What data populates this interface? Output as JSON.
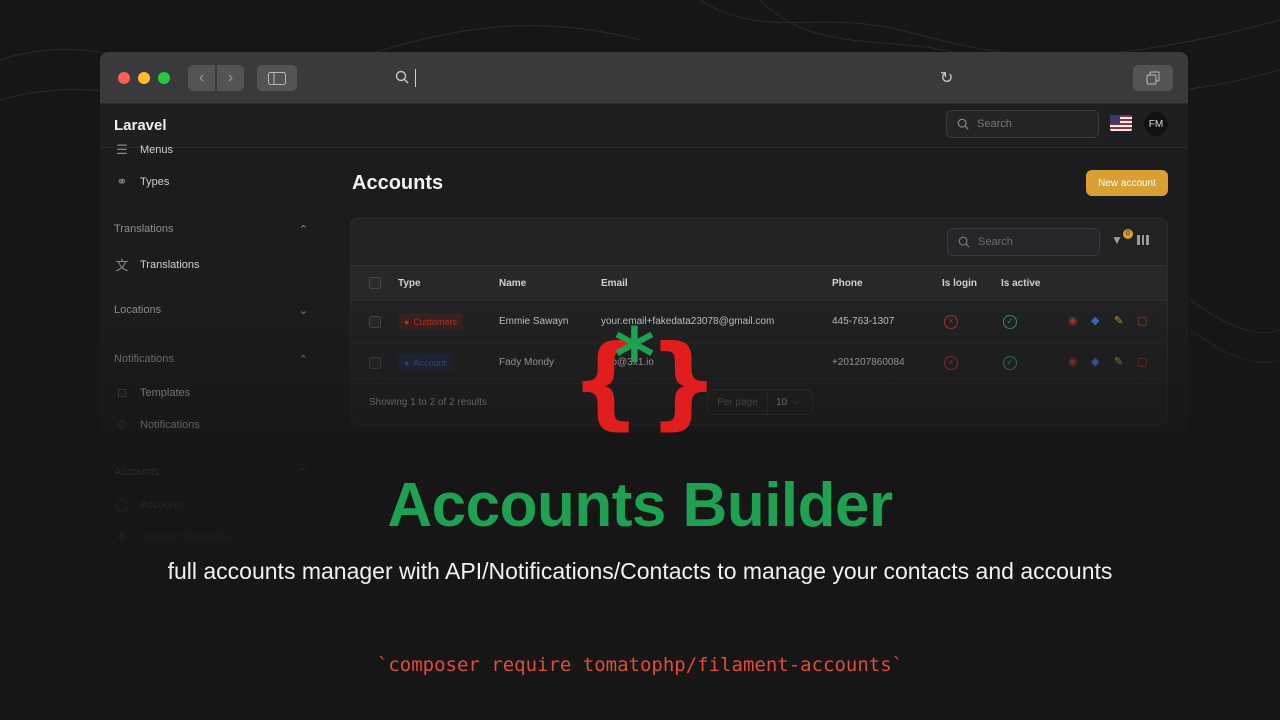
{
  "browser": {
    "url_value": ""
  },
  "app": {
    "brand": "Laravel",
    "search_placeholder": "Search",
    "user_initials": "FM"
  },
  "sidebar": {
    "items_top": [
      {
        "label": "Menus",
        "icon": "menu-icon"
      },
      {
        "label": "Types",
        "icon": "tag-icon"
      }
    ],
    "groups": [
      {
        "label": "Translations",
        "items": [
          {
            "label": "Translations",
            "icon": "translate-icon"
          }
        ]
      },
      {
        "label": "Locations",
        "items": []
      },
      {
        "label": "Notifications",
        "items": [
          {
            "label": "Templates",
            "icon": "bookmark-icon"
          },
          {
            "label": "Notifications",
            "icon": "bell-icon"
          }
        ]
      },
      {
        "label": "Accounts",
        "items": [
          {
            "label": "Accounts",
            "icon": "user-circle-icon"
          },
          {
            "label": "Account Requests",
            "icon": "fingerprint-icon"
          }
        ]
      },
      {
        "label": "ALC",
        "items": []
      }
    ]
  },
  "main": {
    "title": "Accounts",
    "new_button": "New account",
    "table": {
      "search_placeholder": "Search",
      "filter_count": "0",
      "columns": [
        "Type",
        "Name",
        "Email",
        "Phone",
        "Is login",
        "Is active"
      ],
      "rows": [
        {
          "type": "Customers",
          "name": "Emmie Sawayn",
          "email": "your.email+fakedata23078@gmail.com",
          "phone": "445-763-1307"
        },
        {
          "type": "Account",
          "name": "Fady Mondy",
          "email": "info@3x1.io",
          "phone": "+201207860084"
        }
      ],
      "showing": "Showing 1 to 2 of 2 results",
      "per_page_label": "Per page",
      "per_page_value": "10"
    }
  },
  "hero": {
    "title": "Accounts Builder",
    "subtitle": "full accounts manager with API/Notifications/Contacts to manage your contacts and accounts",
    "command": "`composer require tomatophp/filament-accounts`"
  },
  "colors": {
    "accent_green": "#1fa152",
    "accent_red": "#e04b3a",
    "button_amber": "#d8a033"
  }
}
